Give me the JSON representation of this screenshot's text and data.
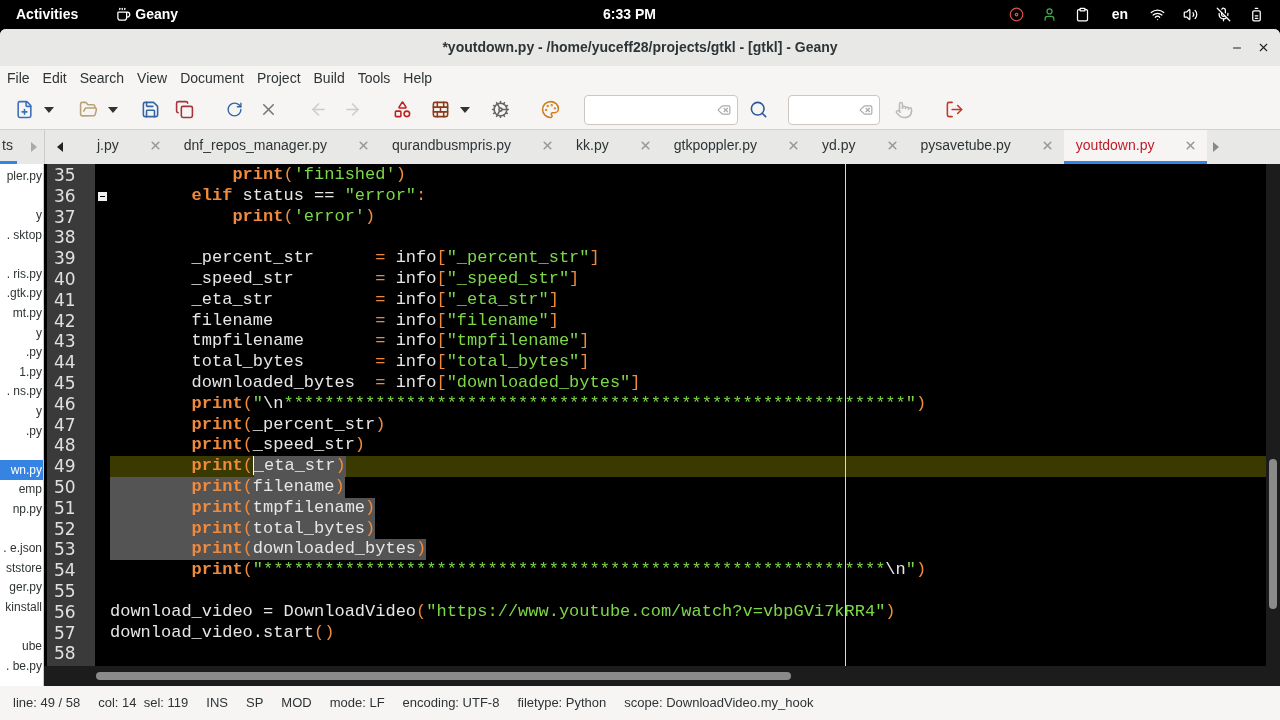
{
  "top_bar": {
    "activities": "Activities",
    "app": "Geany",
    "clock": "6:33 PM",
    "keyboard": "en"
  },
  "window": {
    "title": "*youtdown.py - /home/yuceff28/projects/gtkl - [gtkl] - Geany"
  },
  "menu": [
    "File",
    "Edit",
    "Search",
    "View",
    "Document",
    "Project",
    "Build",
    "Tools",
    "Help"
  ],
  "sidebar": {
    "tab": {
      "label": "ts",
      "selected": true
    },
    "items": [
      {
        "kind": "file",
        "text": "pler.py",
        "selected": false
      },
      {
        "kind": "spacer"
      },
      {
        "kind": "file",
        "text": "y",
        "selected": false
      },
      {
        "kind": "file",
        "text": ". sktop",
        "selected": false
      },
      {
        "kind": "spacer"
      },
      {
        "kind": "file",
        "text": ". ris.py",
        "selected": false
      },
      {
        "kind": "file",
        "text": ".gtk.py",
        "selected": false
      },
      {
        "kind": "file",
        "text": "mt.py",
        "selected": false
      },
      {
        "kind": "file",
        "text": "y",
        "selected": false
      },
      {
        "kind": "file",
        "text": ".py",
        "selected": false
      },
      {
        "kind": "file",
        "text": "1.py",
        "selected": false
      },
      {
        "kind": "file",
        "text": ". ns.py",
        "selected": false
      },
      {
        "kind": "file",
        "text": "y",
        "selected": false
      },
      {
        "kind": "file",
        "text": ".py",
        "selected": false
      },
      {
        "kind": "spacer"
      },
      {
        "kind": "file",
        "text": "wn.py",
        "selected": true
      },
      {
        "kind": "file",
        "text": "emp",
        "selected": false
      },
      {
        "kind": "file",
        "text": "np.py",
        "selected": false
      },
      {
        "kind": "spacer"
      },
      {
        "kind": "file",
        "text": ". e.json",
        "selected": false
      },
      {
        "kind": "file",
        "text": "ststore",
        "selected": false
      },
      {
        "kind": "file",
        "text": "ger.py",
        "selected": false
      },
      {
        "kind": "file",
        "text": "kinstall",
        "selected": false
      },
      {
        "kind": "spacer"
      },
      {
        "kind": "file",
        "text": "ube",
        "selected": false
      },
      {
        "kind": "file",
        "text": ". be.py",
        "selected": false
      }
    ]
  },
  "tabs": [
    {
      "label": "j.py",
      "selected": false
    },
    {
      "label": "dnf_repos_manager.py",
      "selected": false
    },
    {
      "label": "qurandbusmpris.py",
      "selected": false
    },
    {
      "label": "kk.py",
      "selected": false
    },
    {
      "label": "gtkpoppler.py",
      "selected": false
    },
    {
      "label": "yd.py",
      "selected": false
    },
    {
      "label": "pysavetube.py",
      "selected": false
    },
    {
      "label": "youtdown.py",
      "selected": true
    }
  ],
  "editor": {
    "lines": [
      {
        "number": "35",
        "fold": false,
        "current": false,
        "tokens": [
          {
            "kind": "keyword",
            "text": "            print",
            "selected": false
          },
          {
            "kind": "punct",
            "text": "(",
            "selected": false
          },
          {
            "kind": "string",
            "text": "'finished'",
            "selected": false
          },
          {
            "kind": "punct",
            "text": ")",
            "selected": false
          }
        ]
      },
      {
        "number": "36",
        "fold": true,
        "current": false,
        "tokens": [
          {
            "kind": "keyword",
            "text": "        elif",
            "selected": false
          },
          {
            "kind": "name",
            "text": " status == ",
            "selected": false
          },
          {
            "kind": "string",
            "text": "\"error\"",
            "selected": false
          },
          {
            "kind": "punct",
            "text": ":",
            "selected": false
          }
        ]
      },
      {
        "number": "37",
        "fold": false,
        "current": false,
        "tokens": [
          {
            "kind": "keyword",
            "text": "            print",
            "selected": false
          },
          {
            "kind": "punct",
            "text": "(",
            "selected": false
          },
          {
            "kind": "string",
            "text": "'error'",
            "selected": false
          },
          {
            "kind": "punct",
            "text": ")",
            "selected": false
          }
        ]
      },
      {
        "number": "38",
        "fold": false,
        "current": false
      },
      {
        "number": "39",
        "fold": false,
        "current": false,
        "tokens": [
          {
            "kind": "name",
            "text": "        _percent_str      ",
            "selected": false
          },
          {
            "kind": "punct",
            "text": "=",
            "selected": false
          },
          {
            "kind": "name",
            "text": " info",
            "selected": false
          },
          {
            "kind": "punct",
            "text": "[",
            "selected": false
          },
          {
            "kind": "string",
            "text": "\"_percent_str\"",
            "selected": false
          },
          {
            "kind": "punct",
            "text": "]",
            "selected": false
          }
        ]
      },
      {
        "number": "40",
        "fold": false,
        "current": false,
        "tokens": [
          {
            "kind": "name",
            "text": "        _speed_str        ",
            "selected": false
          },
          {
            "kind": "punct",
            "text": "=",
            "selected": false
          },
          {
            "kind": "name",
            "text": " info",
            "selected": false
          },
          {
            "kind": "punct",
            "text": "[",
            "selected": false
          },
          {
            "kind": "string",
            "text": "\"_speed_str\"",
            "selected": false
          },
          {
            "kind": "punct",
            "text": "]",
            "selected": false
          }
        ]
      },
      {
        "number": "41",
        "fold": false,
        "current": false,
        "tokens": [
          {
            "kind": "name",
            "text": "        _eta_str          ",
            "selected": false
          },
          {
            "kind": "punct",
            "text": "=",
            "selected": false
          },
          {
            "kind": "name",
            "text": " info",
            "selected": false
          },
          {
            "kind": "punct",
            "text": "[",
            "selected": false
          },
          {
            "kind": "string",
            "text": "\"_eta_str\"",
            "selected": false
          },
          {
            "kind": "punct",
            "text": "]",
            "selected": false
          }
        ]
      },
      {
        "number": "42",
        "fold": false,
        "current": false,
        "tokens": [
          {
            "kind": "name",
            "text": "        filename          ",
            "selected": false
          },
          {
            "kind": "punct",
            "text": "=",
            "selected": false
          },
          {
            "kind": "name",
            "text": " info",
            "selected": false
          },
          {
            "kind": "punct",
            "text": "[",
            "selected": false
          },
          {
            "kind": "string",
            "text": "\"filename\"",
            "selected": false
          },
          {
            "kind": "punct",
            "text": "]",
            "selected": false
          }
        ]
      },
      {
        "number": "43",
        "fold": false,
        "current": false,
        "tokens": [
          {
            "kind": "name",
            "text": "        tmpfilename       ",
            "selected": false
          },
          {
            "kind": "punct",
            "text": "=",
            "selected": false
          },
          {
            "kind": "name",
            "text": " info",
            "selected": false
          },
          {
            "kind": "punct",
            "text": "[",
            "selected": false
          },
          {
            "kind": "string",
            "text": "\"tmpfilename\"",
            "selected": false
          },
          {
            "kind": "punct",
            "text": "]",
            "selected": false
          }
        ]
      },
      {
        "number": "44",
        "fold": false,
        "current": false,
        "tokens": [
          {
            "kind": "name",
            "text": "        total_bytes       ",
            "selected": false
          },
          {
            "kind": "punct",
            "text": "=",
            "selected": false
          },
          {
            "kind": "name",
            "text": " info",
            "selected": false
          },
          {
            "kind": "punct",
            "text": "[",
            "selected": false
          },
          {
            "kind": "string",
            "text": "\"total_bytes\"",
            "selected": false
          },
          {
            "kind": "punct",
            "text": "]",
            "selected": false
          }
        ]
      },
      {
        "number": "45",
        "fold": false,
        "current": false,
        "tokens": [
          {
            "kind": "name",
            "text": "        downloaded_bytes  ",
            "selected": false
          },
          {
            "kind": "punct",
            "text": "=",
            "selected": false
          },
          {
            "kind": "name",
            "text": " info",
            "selected": false
          },
          {
            "kind": "punct",
            "text": "[",
            "selected": false
          },
          {
            "kind": "string",
            "text": "\"downloaded_bytes\"",
            "selected": false
          },
          {
            "kind": "punct",
            "text": "]",
            "selected": false
          }
        ]
      },
      {
        "number": "46",
        "fold": false,
        "current": false,
        "tokens": [
          {
            "kind": "keyword",
            "text": "        print",
            "selected": false
          },
          {
            "kind": "punct",
            "text": "(",
            "selected": false
          },
          {
            "kind": "string",
            "text": "\"",
            "selected": false
          },
          {
            "kind": "escape",
            "text": "\\n",
            "selected": false
          },
          {
            "kind": "string",
            "text": "*************************************************************\"",
            "selected": false
          },
          {
            "kind": "punct",
            "text": ")",
            "selected": false
          }
        ]
      },
      {
        "number": "47",
        "fold": false,
        "current": false,
        "tokens": [
          {
            "kind": "keyword",
            "text": "        print",
            "selected": false
          },
          {
            "kind": "punct",
            "text": "(",
            "selected": false
          },
          {
            "kind": "name",
            "text": "_percent_str",
            "selected": false
          },
          {
            "kind": "punct",
            "text": ")",
            "selected": false
          }
        ]
      },
      {
        "number": "48",
        "fold": false,
        "current": false,
        "tokens": [
          {
            "kind": "keyword",
            "text": "        print",
            "selected": false
          },
          {
            "kind": "punct",
            "text": "(",
            "selected": false
          },
          {
            "kind": "name",
            "text": "_speed_str",
            "selected": false
          },
          {
            "kind": "punct",
            "text": ")",
            "selected": false
          }
        ]
      },
      {
        "number": "49",
        "fold": false,
        "current": true,
        "tokens": [
          {
            "kind": "keyword",
            "text": "        print",
            "selected": false
          },
          {
            "kind": "punct",
            "text": "(",
            "selected": false
          },
          {
            "kind": "name",
            "text": "_eta_str",
            "selected": true
          },
          {
            "kind": "punct",
            "text": ")",
            "selected": true
          }
        ]
      },
      {
        "number": "50",
        "fold": false,
        "current": false,
        "tokens": [
          {
            "kind": "keyword",
            "text": "        print",
            "selected": true
          },
          {
            "kind": "punct",
            "text": "(",
            "selected": true
          },
          {
            "kind": "name",
            "text": "filename",
            "selected": true
          },
          {
            "kind": "punct",
            "text": ")",
            "selected": true
          }
        ]
      },
      {
        "number": "51",
        "fold": false,
        "current": false,
        "tokens": [
          {
            "kind": "keyword",
            "text": "        print",
            "selected": true
          },
          {
            "kind": "punct",
            "text": "(",
            "selected": true
          },
          {
            "kind": "name",
            "text": "tmpfilename",
            "selected": true
          },
          {
            "kind": "punct",
            "text": ")",
            "selected": true
          }
        ]
      },
      {
        "number": "52",
        "fold": false,
        "current": false,
        "tokens": [
          {
            "kind": "keyword",
            "text": "        print",
            "selected": true
          },
          {
            "kind": "punct",
            "text": "(",
            "selected": true
          },
          {
            "kind": "name",
            "text": "total_bytes",
            "selected": true
          },
          {
            "kind": "punct",
            "text": ")",
            "selected": true
          }
        ]
      },
      {
        "number": "53",
        "fold": false,
        "current": false,
        "tokens": [
          {
            "kind": "keyword",
            "text": "        print",
            "selected": true
          },
          {
            "kind": "punct",
            "text": "(",
            "selected": true
          },
          {
            "kind": "name",
            "text": "downloaded_bytes",
            "selected": true
          },
          {
            "kind": "punct",
            "text": ")",
            "selected": true
          }
        ]
      },
      {
        "number": "54",
        "fold": false,
        "current": false,
        "tokens": [
          {
            "kind": "keyword",
            "text": "        print",
            "selected": false
          },
          {
            "kind": "punct",
            "text": "(",
            "selected": false
          },
          {
            "kind": "string",
            "text": "\"*************************************************************",
            "selected": false
          },
          {
            "kind": "escape",
            "text": "\\n",
            "selected": false
          },
          {
            "kind": "string",
            "text": "\"",
            "selected": false
          },
          {
            "kind": "punct",
            "text": ")",
            "selected": false
          }
        ]
      },
      {
        "number": "55",
        "fold": false,
        "current": false
      },
      {
        "number": "56",
        "fold": false,
        "current": false,
        "tokens": [
          {
            "kind": "name",
            "text": "download_video = DownloadVideo",
            "selected": false
          },
          {
            "kind": "punct",
            "text": "(",
            "selected": false
          },
          {
            "kind": "string",
            "text": "\"https://www.youtube.com/watch?v=vbpGVi7kRR4\"",
            "selected": false
          },
          {
            "kind": "punct",
            "text": ")",
            "selected": false
          }
        ]
      },
      {
        "number": "57",
        "fold": false,
        "current": false,
        "tokens": [
          {
            "kind": "name",
            "text": "download_video.start",
            "selected": false
          },
          {
            "kind": "punct",
            "text": "()",
            "selected": false
          }
        ]
      },
      {
        "number": "58",
        "fold": false,
        "current": false
      }
    ]
  },
  "status_bar": [
    "line: 49 / 58",
    "col: 14  sel: 119",
    "INS",
    "SP",
    "MOD",
    "mode: LF",
    "encoding: UTF-8",
    "filetype: Python",
    "scope: DownloadVideo.my_hook"
  ]
}
